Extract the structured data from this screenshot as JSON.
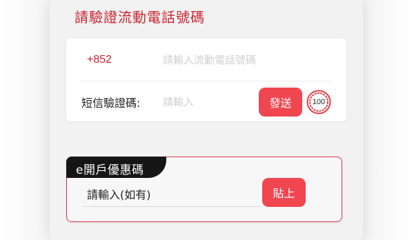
{
  "title": "請驗證流動電話號碼",
  "phone": {
    "country_code": "+852",
    "placeholder": "請輸入流動電話號碼"
  },
  "sms": {
    "label": "短信驗證碼:",
    "placeholder": "請輸入",
    "send_label": "發送",
    "countdown": "100"
  },
  "promo": {
    "tag": "e開戶優惠碼",
    "placeholder": "請輸入(如有)",
    "paste_label": "貼上"
  },
  "colors": {
    "accent": "#f04650",
    "title": "#c9242f",
    "tag_bg": "#151515"
  }
}
